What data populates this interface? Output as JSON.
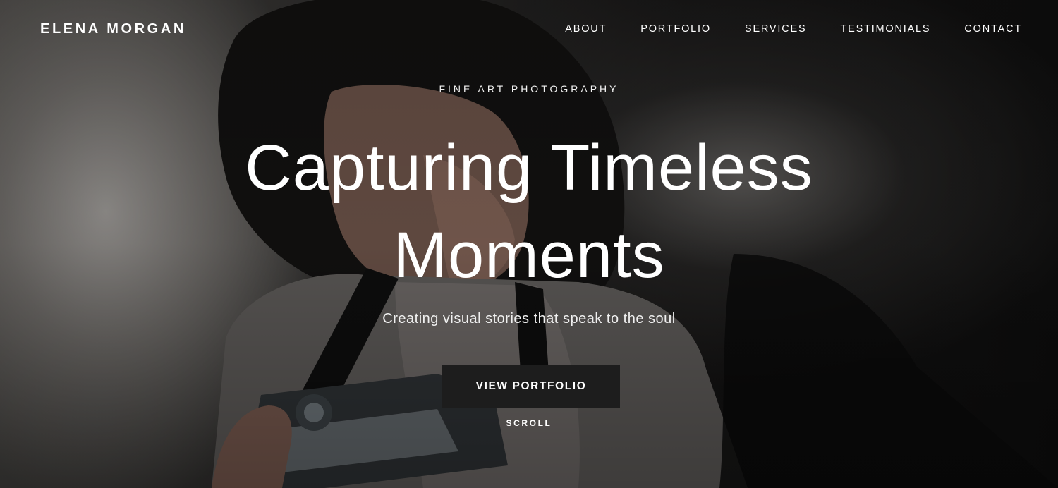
{
  "brand": {
    "name": "ELENA MORGAN"
  },
  "nav": {
    "items": [
      {
        "label": "ABOUT"
      },
      {
        "label": "PORTFOLIO"
      },
      {
        "label": "SERVICES"
      },
      {
        "label": "TESTIMONIALS"
      },
      {
        "label": "CONTACT"
      }
    ]
  },
  "hero": {
    "eyebrow": "FINE ART PHOTOGRAPHY",
    "headline_line1": "Capturing Timeless",
    "headline_line2": "Moments",
    "subtitle": "Creating visual stories that speak to the soul",
    "cta_label": "VIEW PORTFOLIO",
    "scroll_label": "SCROLL"
  },
  "colors": {
    "text": "#ffffff",
    "button_bg": "#1d1d1d"
  }
}
